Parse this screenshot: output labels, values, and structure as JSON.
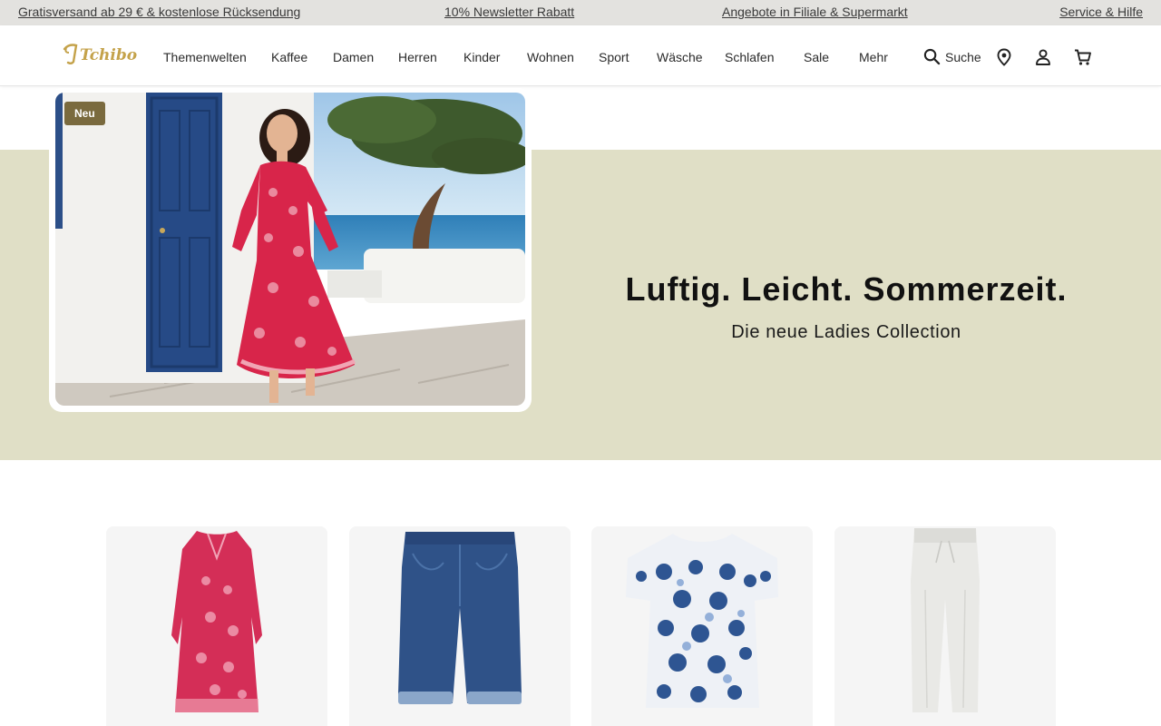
{
  "topbar": {
    "shipping": "Gratisversand ab 29 € & kostenlose Rücksendung",
    "newsletter": "10% Newsletter Rabatt",
    "offers": "Angebote in Filiale & Supermarkt",
    "service": "Service & Hilfe"
  },
  "header": {
    "logo_text": "Tchibo",
    "nav": [
      "Themenwelten",
      "Kaffee",
      "Damen",
      "Herren",
      "Kinder",
      "Wohnen",
      "Sport",
      "Wäsche",
      "Schlafen",
      "Sale",
      "Mehr"
    ],
    "search_label": "Suche",
    "icons": [
      "search-icon",
      "location-icon",
      "account-icon",
      "cart-icon"
    ]
  },
  "hero": {
    "badge": "Neu",
    "title": "Luftig. Leicht. Sommerzeit.",
    "subtitle": "Die neue Ladies Collection"
  },
  "products": [
    {
      "name": "red-floral-dress"
    },
    {
      "name": "denim-shorts"
    },
    {
      "name": "blue-print-shirt"
    },
    {
      "name": "white-linen-pants"
    }
  ],
  "colors": {
    "hero_band": "#e0dfc6",
    "badge": "#7a6a3e",
    "logo": "#c4a24a",
    "topbar": "#e3e2df"
  }
}
